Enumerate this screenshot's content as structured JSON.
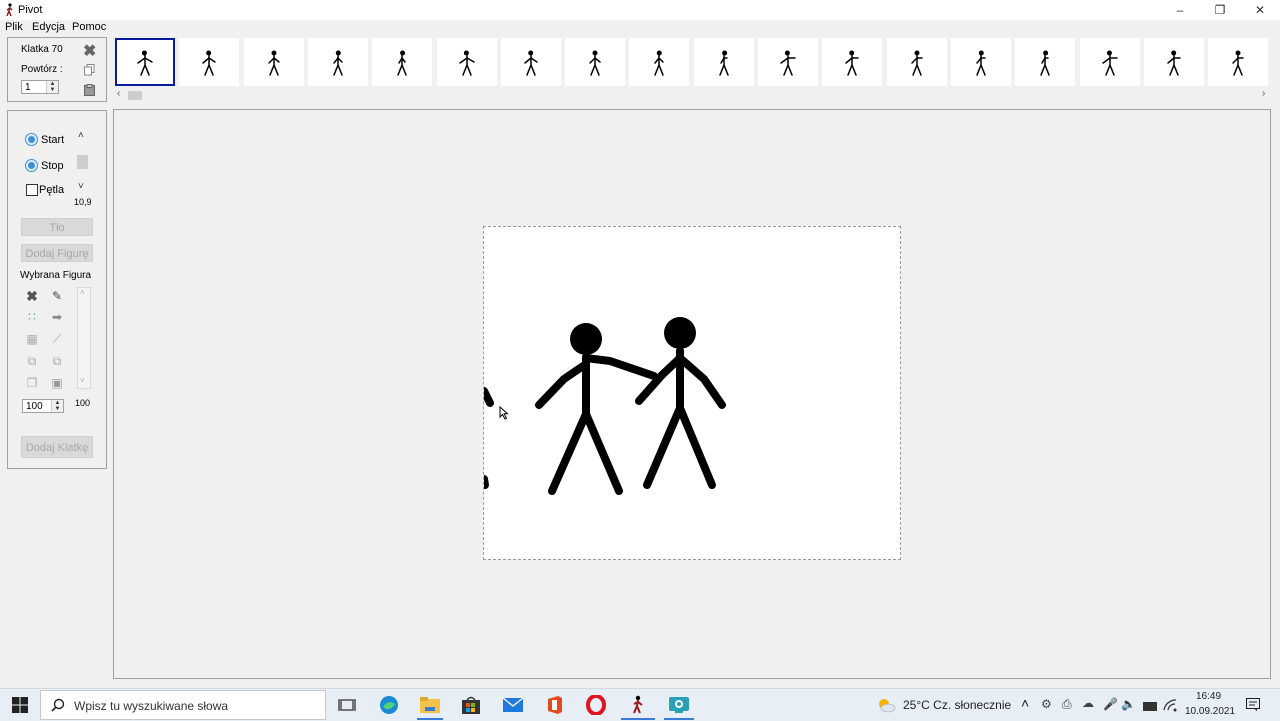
{
  "window": {
    "title": "Pivot",
    "controls": [
      "minimize",
      "maximize",
      "close"
    ]
  },
  "menu": [
    "Plik",
    "Edycja",
    "Pomoc"
  ],
  "frame_panel": {
    "frame_label": "Klatka 70",
    "repeat_label": "Powtórz :",
    "repeat_value": "1"
  },
  "frames_strip": {
    "selected_index": 0,
    "thumb_count": 18
  },
  "playback": {
    "start_label": "Start",
    "stop_label": "Stop",
    "loop_label": "Pętla",
    "loop_checked": false,
    "speed_value": "10,9"
  },
  "buttons": {
    "background": "Tło",
    "add_figure": "Dodaj Figurę",
    "add_frame": "Dodaj Klatkę"
  },
  "selected_figure": {
    "label": "Wybrana Figura",
    "scale_value": "100",
    "slider_value": "100"
  },
  "taskbar": {
    "search_placeholder": "Wpisz tu wyszukiwane słowa",
    "weather": "25°C  Cz. słonecznie",
    "time": "16:49",
    "date": "10.09.2021"
  },
  "colors": {
    "selection": "#0a1aa0",
    "accent": "#3a8fd8"
  }
}
